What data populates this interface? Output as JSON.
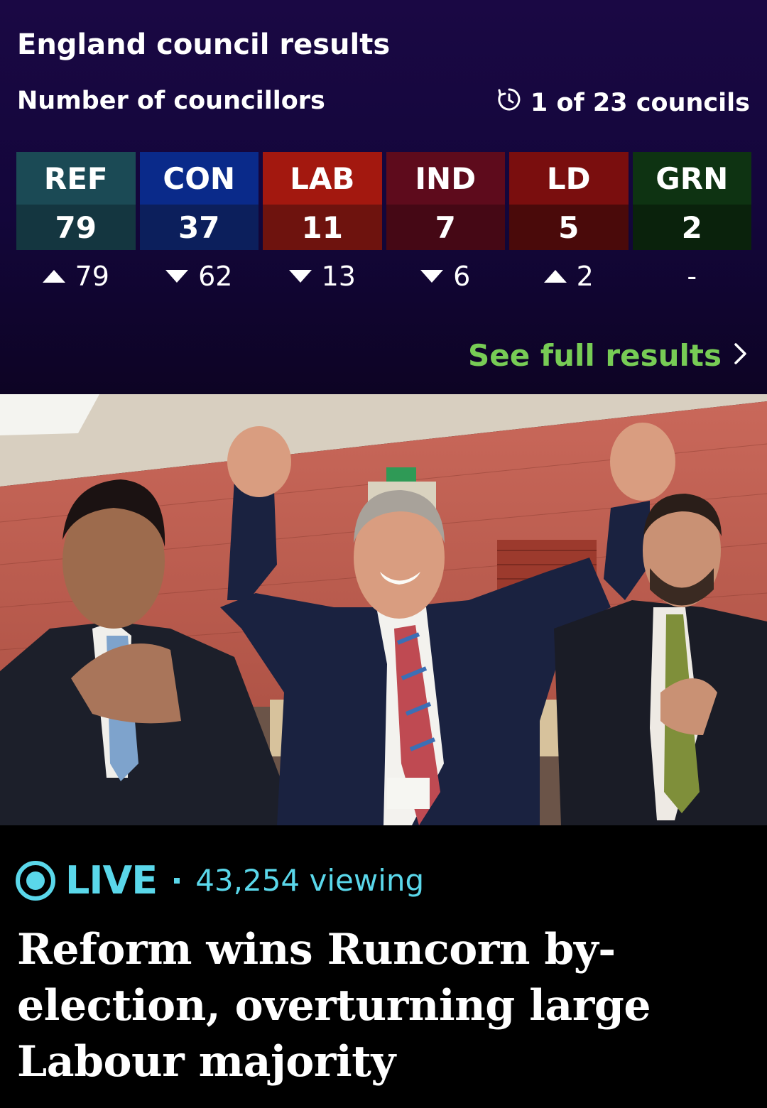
{
  "results": {
    "title": "England council results",
    "subtitle": "Number of councillors",
    "progress_text": "1 of 23 councils",
    "progress_icon": "clock-refresh-icon",
    "see_full_label": "See full results",
    "parties": [
      {
        "abbr": "REF",
        "seats": "79",
        "direction": "up",
        "change": "79",
        "header_color": "#1b4a55",
        "seats_color": "#143640"
      },
      {
        "abbr": "CON",
        "seats": "37",
        "direction": "down",
        "change": "62",
        "header_color": "#0a2a8a",
        "seats_color": "#0c1f5c"
      },
      {
        "abbr": "LAB",
        "seats": "11",
        "direction": "down",
        "change": "13",
        "header_color": "#a3180f",
        "seats_color": "#6e130e"
      },
      {
        "abbr": "IND",
        "seats": "7",
        "direction": "down",
        "change": "6",
        "header_color": "#5e0b1c",
        "seats_color": "#450815"
      },
      {
        "abbr": "LD",
        "seats": "5",
        "direction": "up",
        "change": "2",
        "header_color": "#7a0e0e",
        "seats_color": "#4a0a0a"
      },
      {
        "abbr": "GRN",
        "seats": "2",
        "direction": "none",
        "change": "-",
        "header_color": "#0e3312",
        "seats_color": "#0a220c"
      }
    ]
  },
  "story": {
    "live_label": "LIVE",
    "viewers": "43,254 viewing",
    "headline": "Reform wins Runcorn by-election, overturning large Labour majority",
    "accent_color": "#5ad7ea"
  }
}
